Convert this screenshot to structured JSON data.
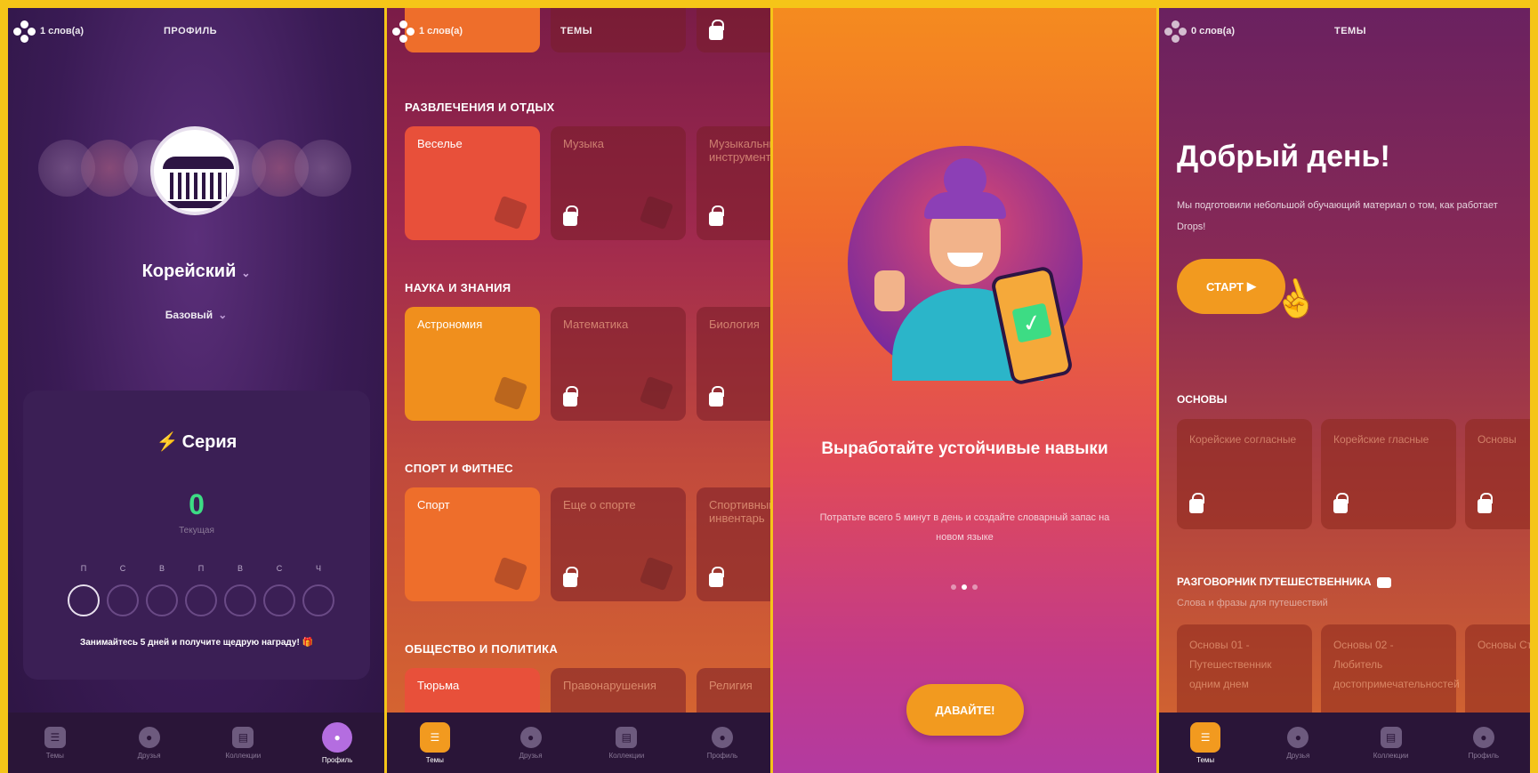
{
  "panel1": {
    "words_count": "1 слов(а)",
    "title": "ПРОФИЛЬ",
    "language": "Корейский",
    "level": "Базовый",
    "streak": {
      "title": "Серия",
      "value": "0",
      "sublabel": "Текущая",
      "days": [
        "П",
        "С",
        "В",
        "П",
        "В",
        "С",
        "Ч"
      ],
      "note": "Занимайтесь 5 дней и получите щедрую награду! 🎁"
    },
    "nav": [
      "Темы",
      "Друзья",
      "Коллекции",
      "Профиль"
    ]
  },
  "panel2": {
    "words_count": "1 слов(а)",
    "title": "ТЕМЫ",
    "sections": [
      {
        "title": "РАЗВЛЕЧЕНИЯ И ОТДЫХ",
        "tiles": [
          "Веселье",
          "Музыка",
          "Музыкальные инструменты"
        ]
      },
      {
        "title": "НАУКА И ЗНАНИЯ",
        "tiles": [
          "Астрономия",
          "Математика",
          "Биология"
        ]
      },
      {
        "title": "СПОРТ И ФИТНЕС",
        "tiles": [
          "Спорт",
          "Еще о спорте",
          "Спортивный инвентарь"
        ]
      },
      {
        "title": "ОБЩЕСТВО И ПОЛИТИКА",
        "tiles": [
          "Тюрьма",
          "Правонарушения",
          "Религия"
        ]
      }
    ],
    "nav": [
      "Темы",
      "Друзья",
      "Коллекции",
      "Профиль"
    ]
  },
  "panel3": {
    "title": "Выработайте устойчивые навыки",
    "text": "Потратьте всего 5 минут в день и создайте словарный запас на новом языке",
    "button": "ДАВАЙТЕ!"
  },
  "panel4": {
    "words_count": "0 слов(а)",
    "title": "ТЕМЫ",
    "greeting": "Добрый день!",
    "greeting_sub": "Мы подготовили небольшой обучающий материал о том, как работает Drops!",
    "start_button": "СТАРТ",
    "section1": {
      "title": "ОСНОВЫ",
      "tiles": [
        "Корейские согласные",
        "Корейские гласные",
        "Основы"
      ]
    },
    "section2": {
      "title": "РАЗГОВОРНИК ПУТЕШЕСТВЕННИКА",
      "subtitle": "Слова и фразы для путешествий",
      "tiles": [
        "Основы 01 - Путешественник одним днем",
        "Основы 02 - Любитель достопримечательностей",
        "Основы Страны"
      ]
    },
    "nav": [
      "Темы",
      "Друзья",
      "Коллекции",
      "Профиль"
    ]
  }
}
